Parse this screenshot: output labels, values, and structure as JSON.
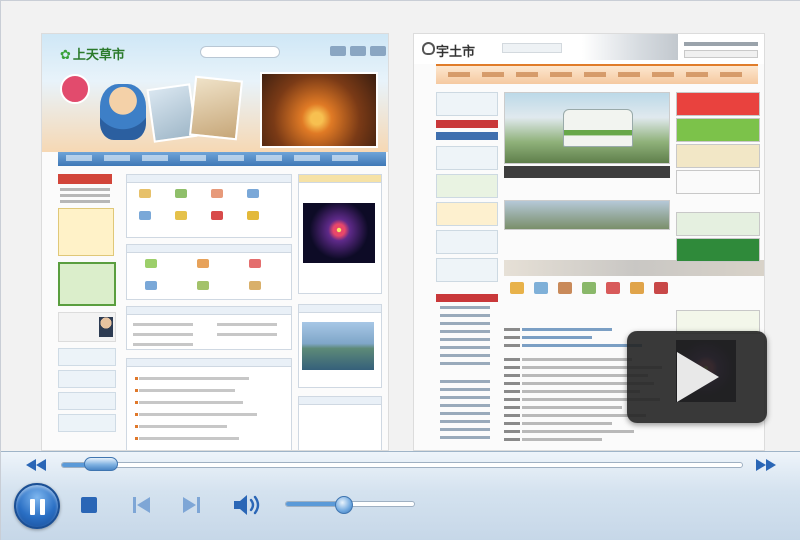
{
  "player": {
    "left_site": {
      "logo_text": "上天草市"
    },
    "right_site": {
      "logo_text": "宇土市"
    },
    "seek": {
      "progress": 0.04
    },
    "volume": {
      "level": 0.45
    },
    "state": "playing",
    "icons": {
      "big_play": "play-icon",
      "rewind": "rewind-icon",
      "fast_forward": "fast-forward-icon",
      "pause": "pause-icon",
      "stop": "stop-icon",
      "previous": "previous-track-icon",
      "next": "next-track-icon",
      "volume": "speaker-icon"
    },
    "colors": {
      "accent": "#2a6fc4",
      "control_bar": "#d4e2ef",
      "overlay": "#242424"
    }
  }
}
